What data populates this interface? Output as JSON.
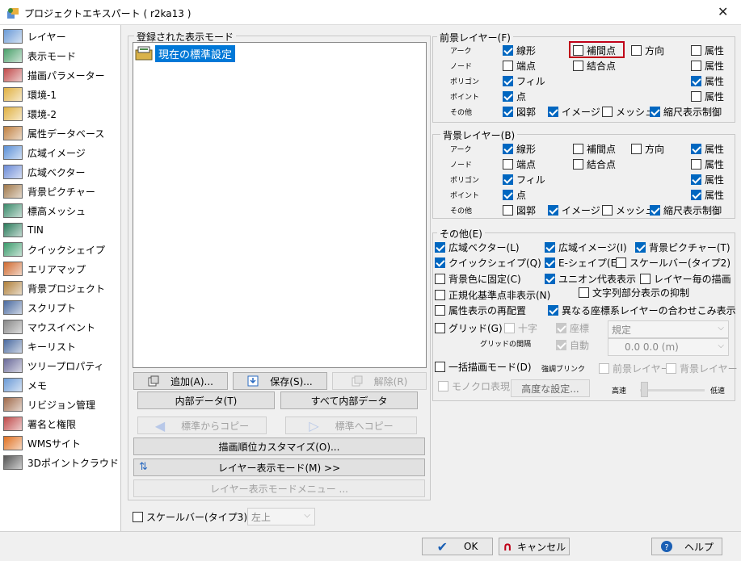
{
  "window": {
    "title": "プロジェクトエキスパート ( r2ka13 )",
    "close_glyph": "✕"
  },
  "sidebar": {
    "items": [
      {
        "label": "レイヤー",
        "icon": "layer-icon"
      },
      {
        "label": "表示モード",
        "icon": "display-mode-icon"
      },
      {
        "label": "描画パラメーター",
        "icon": "draw-param-icon"
      },
      {
        "label": "環境-1",
        "icon": "environment-icon"
      },
      {
        "label": "環境-2",
        "icon": "environment-icon"
      },
      {
        "label": "属性データベース",
        "icon": "attribute-db-icon"
      },
      {
        "label": "広域イメージ",
        "icon": "wide-image-icon"
      },
      {
        "label": "広域ベクター",
        "icon": "wide-vector-icon"
      },
      {
        "label": "背景ピクチャー",
        "icon": "background-picture-icon"
      },
      {
        "label": "標高メッシュ",
        "icon": "elevation-mesh-icon"
      },
      {
        "label": "TIN",
        "icon": "tin-icon"
      },
      {
        "label": "クイックシェイプ",
        "icon": "quick-shape-icon"
      },
      {
        "label": "エリアマップ",
        "icon": "area-map-icon"
      },
      {
        "label": "背景プロジェクト",
        "icon": "background-project-icon"
      },
      {
        "label": "スクリプト",
        "icon": "script-icon"
      },
      {
        "label": "マウスイベント",
        "icon": "mouse-icon"
      },
      {
        "label": "キーリスト",
        "icon": "key-list-icon"
      },
      {
        "label": "ツリープロパティ",
        "icon": "tree-property-icon"
      },
      {
        "label": "メモ",
        "icon": "memo-icon"
      },
      {
        "label": "リビジョン管理",
        "icon": "revision-icon"
      },
      {
        "label": "署名と権限",
        "icon": "signature-icon"
      },
      {
        "label": "WMSサイト",
        "icon": "wms-icon"
      },
      {
        "label": "3Dポイントクラウド",
        "icon": "point-cloud-icon"
      }
    ]
  },
  "modes": {
    "group_label": "登録された表示モード",
    "selected": "現在の標準設定"
  },
  "buttons": {
    "add": "追加(A)...",
    "save": "保存(S)...",
    "remove": "解除(R)",
    "internal": "内部データ(T)",
    "all_internal": "すべて内部データ",
    "copy_from": "標準からコピー",
    "copy_to": "標準へコピー",
    "draw_order": "描画順位カスタマイズ(O)...",
    "layer_mode": "レイヤー表示モード(M) >>",
    "layer_mode_menu": "レイヤー表示モードメニュー ..."
  },
  "scalebar3": {
    "label": "スケールバー(タイプ3)",
    "value": "左上"
  },
  "foreground": {
    "title": "前景レイヤー(F)",
    "rows": [
      "アーク",
      "ノード",
      "ポリゴン",
      "ポイント",
      "その他"
    ],
    "arc": {
      "a": "線形",
      "b": "補間点",
      "c": "方向",
      "d": "属性"
    },
    "node": {
      "a": "端点",
      "b": "結合点",
      "d": "属性"
    },
    "polygon": {
      "a": "フィル",
      "d": "属性"
    },
    "point": {
      "a": "点",
      "d": "属性"
    },
    "other": {
      "a": "図郭",
      "b": "イメージ",
      "c": "メッシュ",
      "d": "縮尺表示制御"
    }
  },
  "background": {
    "title": "背景レイヤー(B)",
    "rows": [
      "アーク",
      "ノード",
      "ポリゴン",
      "ポイント",
      "その他"
    ],
    "arc": {
      "a": "線形",
      "b": "補間点",
      "c": "方向",
      "d": "属性"
    },
    "node": {
      "a": "端点",
      "b": "結合点",
      "d": "属性"
    },
    "polygon": {
      "a": "フィル",
      "d": "属性"
    },
    "point": {
      "a": "点",
      "d": "属性"
    },
    "other": {
      "a": "図郭",
      "b": "イメージ",
      "c": "メッシュ",
      "d": "縮尺表示制御"
    }
  },
  "others": {
    "title": "その他(E)",
    "wide_vector": "広域ベクター(L)",
    "wide_image": "広域イメージ(I)",
    "bg_picture": "背景ピクチャー(T)",
    "quick_shape": "クイックシェイプ(Q)",
    "e_shape": "E-シェイプ(E)",
    "scalebar2": "スケールバー(タイプ2)",
    "fix_bg": "背景色に固定(C)",
    "union": "ユニオン代表表示",
    "per_layer": "レイヤー毎の描画",
    "hide_norm": "正規化基準点非表示(N)",
    "suppress_text": "文字列部分表示の抑制",
    "relayout": "属性表示の再配置",
    "overlay_crs": "異なる座標系レイヤーの合わせこみ表示",
    "grid": "グリッド(G)",
    "cross": "十字",
    "coord": "座標",
    "grid_interval": "グリッドの間隔",
    "auto": "自動",
    "combo_std": "規定",
    "combo_val": "0.0    0.0 (m)",
    "batch": "一括描画モード(D)",
    "emphasis": "強調ブリンク",
    "fg_layer": "前景レイヤー",
    "bg_layer": "背景レイヤー",
    "mono": "モノクロ表現",
    "advanced": "高度な設定...",
    "fast": "高速",
    "slow": "低速"
  },
  "footer": {
    "ok": "OK",
    "cancel": "キャンセル",
    "help": "ヘルプ"
  },
  "colors": {
    "accent": "#0067c0",
    "highlight": "#c00018",
    "selection": "#0078d7"
  }
}
